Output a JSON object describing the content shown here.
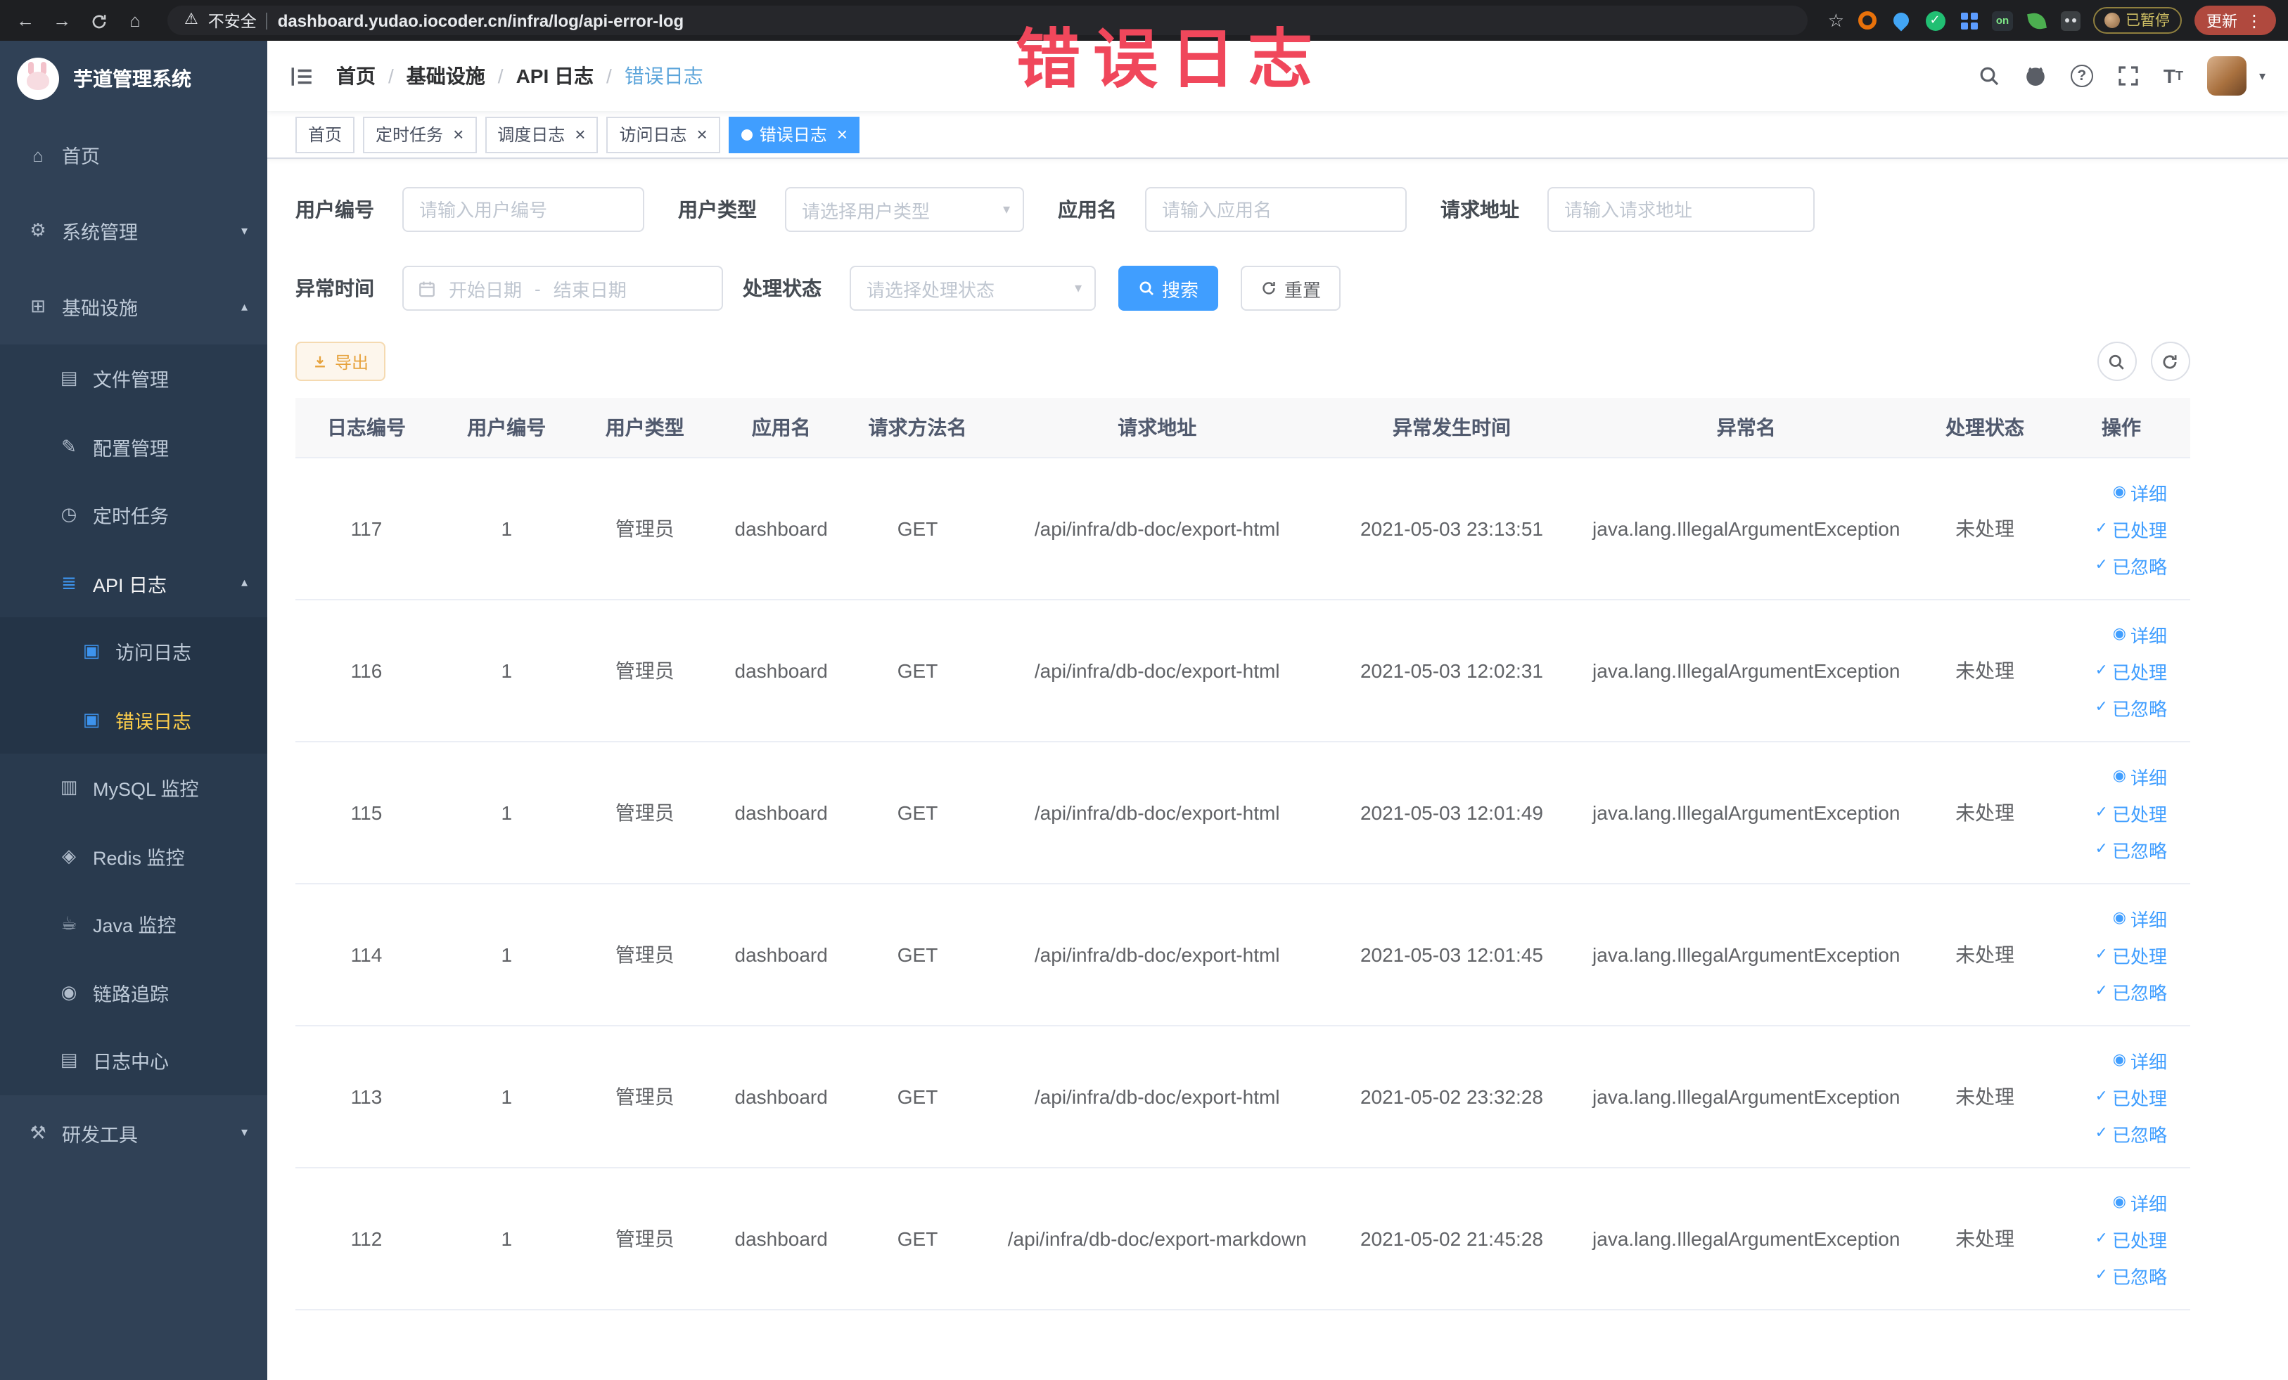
{
  "watermark": "错误日志",
  "browser": {
    "security_label": "不安全",
    "url": "dashboard.yudao.iocoder.cn/infra/log/api-error-log",
    "paused_badge": "已暂停",
    "update_button": "更新"
  },
  "sidebar": {
    "title": "芋道管理系统",
    "items": [
      {
        "key": "home",
        "label": "首页",
        "icon": "home-icon",
        "level": 1
      },
      {
        "key": "system",
        "label": "系统管理",
        "icon": "gear-icon",
        "level": 1,
        "chevron": "down"
      },
      {
        "key": "infra",
        "label": "基础设施",
        "icon": "infra-icon",
        "level": 1,
        "chevron": "up"
      },
      {
        "key": "file",
        "label": "文件管理",
        "icon": "folder-icon",
        "level": 2
      },
      {
        "key": "config",
        "label": "配置管理",
        "icon": "config-icon",
        "level": 2
      },
      {
        "key": "job",
        "label": "定时任务",
        "icon": "clock-icon",
        "level": 2
      },
      {
        "key": "api-log",
        "label": "API 日志",
        "icon": "api-log-icon",
        "icon_color": "#409eff",
        "level": 2,
        "chevron": "up",
        "parent_active": true
      },
      {
        "key": "access-log",
        "label": "访问日志",
        "icon": "doc-icon",
        "icon_color": "#409eff",
        "level": 3
      },
      {
        "key": "error-log",
        "label": "错误日志",
        "icon": "doc-icon",
        "icon_color": "#409eff",
        "level": 3,
        "active": true
      },
      {
        "key": "mysql",
        "label": "MySQL 监控",
        "icon": "mysql-icon",
        "level": 2
      },
      {
        "key": "redis",
        "label": "Redis 监控",
        "icon": "redis-icon",
        "level": 2
      },
      {
        "key": "java",
        "label": "Java 监控",
        "icon": "java-icon",
        "level": 2
      },
      {
        "key": "trace",
        "label": "链路追踪",
        "icon": "trace-icon",
        "level": 2
      },
      {
        "key": "log-center",
        "label": "日志中心",
        "icon": "log-center-icon",
        "level": 2
      },
      {
        "key": "dev-tools",
        "label": "研发工具",
        "icon": "tools-icon",
        "level": 1,
        "chevron": "down"
      }
    ]
  },
  "breadcrumb": [
    "首页",
    "基础设施",
    "API 日志",
    "错误日志"
  ],
  "tabs": [
    {
      "label": "首页",
      "closable": false,
      "active": false
    },
    {
      "label": "定时任务",
      "closable": true,
      "active": false
    },
    {
      "label": "调度日志",
      "closable": true,
      "active": false
    },
    {
      "label": "访问日志",
      "closable": true,
      "active": false
    },
    {
      "label": "错误日志",
      "closable": true,
      "active": true
    }
  ],
  "filters": {
    "user_id_label": "用户编号",
    "user_id_placeholder": "请输入用户编号",
    "user_type_label": "用户类型",
    "user_type_placeholder": "请选择用户类型",
    "app_name_label": "应用名",
    "app_name_placeholder": "请输入应用名",
    "request_url_label": "请求地址",
    "request_url_placeholder": "请输入请求地址",
    "exception_time_label": "异常时间",
    "date_start_placeholder": "开始日期",
    "date_separator": "-",
    "date_end_placeholder": "结束日期",
    "process_status_label": "处理状态",
    "process_status_placeholder": "请选择处理状态",
    "search_button": "搜索",
    "reset_button": "重置"
  },
  "toolbar": {
    "export_button": "导出"
  },
  "table": {
    "columns": [
      "日志编号",
      "用户编号",
      "用户类型",
      "应用名",
      "请求方法名",
      "请求地址",
      "异常发生时间",
      "异常名",
      "处理状态",
      "操作"
    ],
    "action_labels": {
      "detail": "详细",
      "processed": "已处理",
      "ignored": "已忽略"
    },
    "rows": [
      {
        "log_id": "117",
        "user_id": "1",
        "user_type": "管理员",
        "app_name": "dashboard",
        "method": "GET",
        "url": "/api/infra/db-doc/export-html",
        "time": "2021-05-03 23:13:51",
        "exception": "java.lang.IllegalArgumentException",
        "status": "未处理"
      },
      {
        "log_id": "116",
        "user_id": "1",
        "user_type": "管理员",
        "app_name": "dashboard",
        "method": "GET",
        "url": "/api/infra/db-doc/export-html",
        "time": "2021-05-03 12:02:31",
        "exception": "java.lang.IllegalArgumentException",
        "status": "未处理"
      },
      {
        "log_id": "115",
        "user_id": "1",
        "user_type": "管理员",
        "app_name": "dashboard",
        "method": "GET",
        "url": "/api/infra/db-doc/export-html",
        "time": "2021-05-03 12:01:49",
        "exception": "java.lang.IllegalArgumentException",
        "status": "未处理"
      },
      {
        "log_id": "114",
        "user_id": "1",
        "user_type": "管理员",
        "app_name": "dashboard",
        "method": "GET",
        "url": "/api/infra/db-doc/export-html",
        "time": "2021-05-03 12:01:45",
        "exception": "java.lang.IllegalArgumentException",
        "status": "未处理"
      },
      {
        "log_id": "113",
        "user_id": "1",
        "user_type": "管理员",
        "app_name": "dashboard",
        "method": "GET",
        "url": "/api/infra/db-doc/export-html",
        "time": "2021-05-02 23:32:28",
        "exception": "java.lang.IllegalArgumentException",
        "status": "未处理"
      },
      {
        "log_id": "112",
        "user_id": "1",
        "user_type": "管理员",
        "app_name": "dashboard",
        "method": "GET",
        "url": "/api/infra/db-doc/export-markdown",
        "time": "2021-05-02 21:45:28",
        "exception": "java.lang.IllegalArgumentException",
        "status": "未处理"
      }
    ]
  },
  "colors": {
    "primary": "#409eff",
    "sidebar_bg": "#304156",
    "active_menu_text": "#ffd04b",
    "warning_text": "#e6a23c",
    "watermark_red": "#f0475b"
  }
}
